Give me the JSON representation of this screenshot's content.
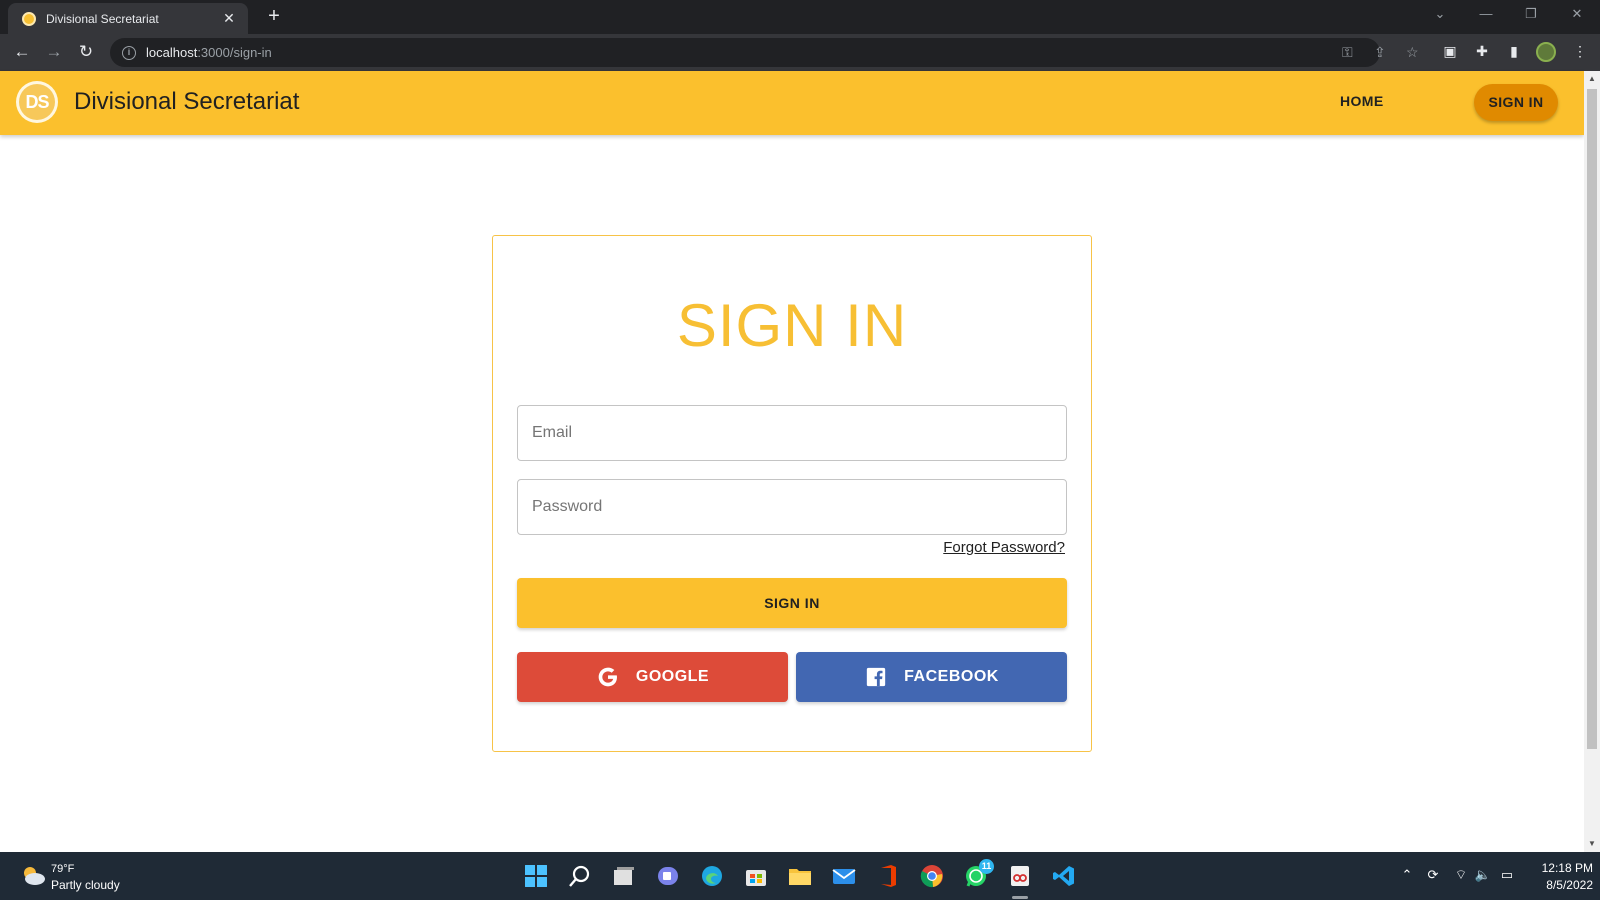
{
  "browser": {
    "tab_title": "Divisional Secretariat",
    "tab_close": "✕",
    "new_tab": "+",
    "url_host": "localhost",
    "url_path": ":3000/sign-in"
  },
  "appbar": {
    "logo_text": "DS",
    "brand": "Divisional Secretariat",
    "home_label": "HOME",
    "signin_label": "SIGN IN"
  },
  "form": {
    "title": "SIGN IN",
    "email_placeholder": "Email",
    "password_placeholder": "Password",
    "forgot_label": "Forgot Password?",
    "submit_label": "SIGN IN",
    "google_label": "GOOGLE",
    "facebook_label": "FACEBOOK"
  },
  "taskbar": {
    "temperature": "79°F",
    "weather": "Partly cloudy",
    "whatsapp_badge": "11",
    "time": "12:18 PM",
    "date": "8/5/2022"
  },
  "colors": {
    "primary": "#fbc02d",
    "accent": "#e08a00",
    "google": "#dd4b39",
    "facebook": "#4267b2"
  }
}
